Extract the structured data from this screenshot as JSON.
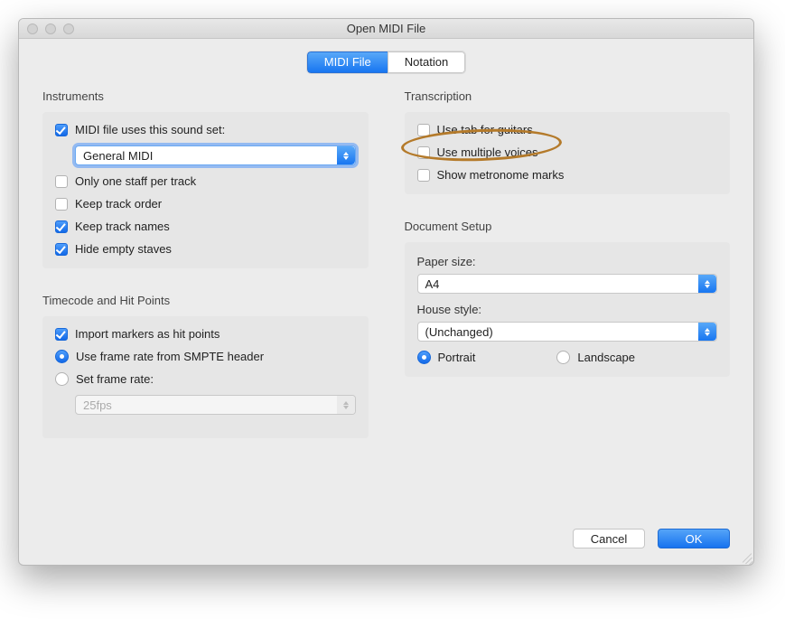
{
  "window": {
    "title": "Open MIDI File"
  },
  "tabs": {
    "midi": "MIDI File",
    "notation": "Notation",
    "active": "midi"
  },
  "instruments": {
    "title": "Instruments",
    "uses_sound_set": {
      "label": "MIDI file uses this sound set:",
      "checked": true
    },
    "sound_set_select": {
      "value": "General MIDI"
    },
    "only_one_staff": {
      "label": "Only one staff per track",
      "checked": false
    },
    "keep_track_order": {
      "label": "Keep track order",
      "checked": false
    },
    "keep_track_names": {
      "label": "Keep track names",
      "checked": true
    },
    "hide_empty_staves": {
      "label": "Hide empty staves",
      "checked": true
    }
  },
  "timecode": {
    "title": "Timecode and Hit Points",
    "import_markers": {
      "label": "Import markers as hit points",
      "checked": true
    },
    "frame_mode": "smpte",
    "use_smpte": {
      "label": "Use frame rate from SMPTE header"
    },
    "set_rate": {
      "label": "Set frame rate:"
    },
    "rate_select": {
      "value": "25fps",
      "disabled": true
    }
  },
  "transcription": {
    "title": "Transcription",
    "use_tab": {
      "label": "Use tab for guitars",
      "checked": false
    },
    "multiple_voices": {
      "label": "Use multiple voices",
      "checked": false
    },
    "metronome": {
      "label": "Show metronome marks",
      "checked": false
    }
  },
  "doc_setup": {
    "title": "Document Setup",
    "paper_label": "Paper size:",
    "paper_value": "A4",
    "house_label": "House style:",
    "house_value": "(Unchanged)",
    "orientation": "portrait",
    "portrait_label": "Portrait",
    "landscape_label": "Landscape"
  },
  "buttons": {
    "cancel": "Cancel",
    "ok": "OK"
  }
}
